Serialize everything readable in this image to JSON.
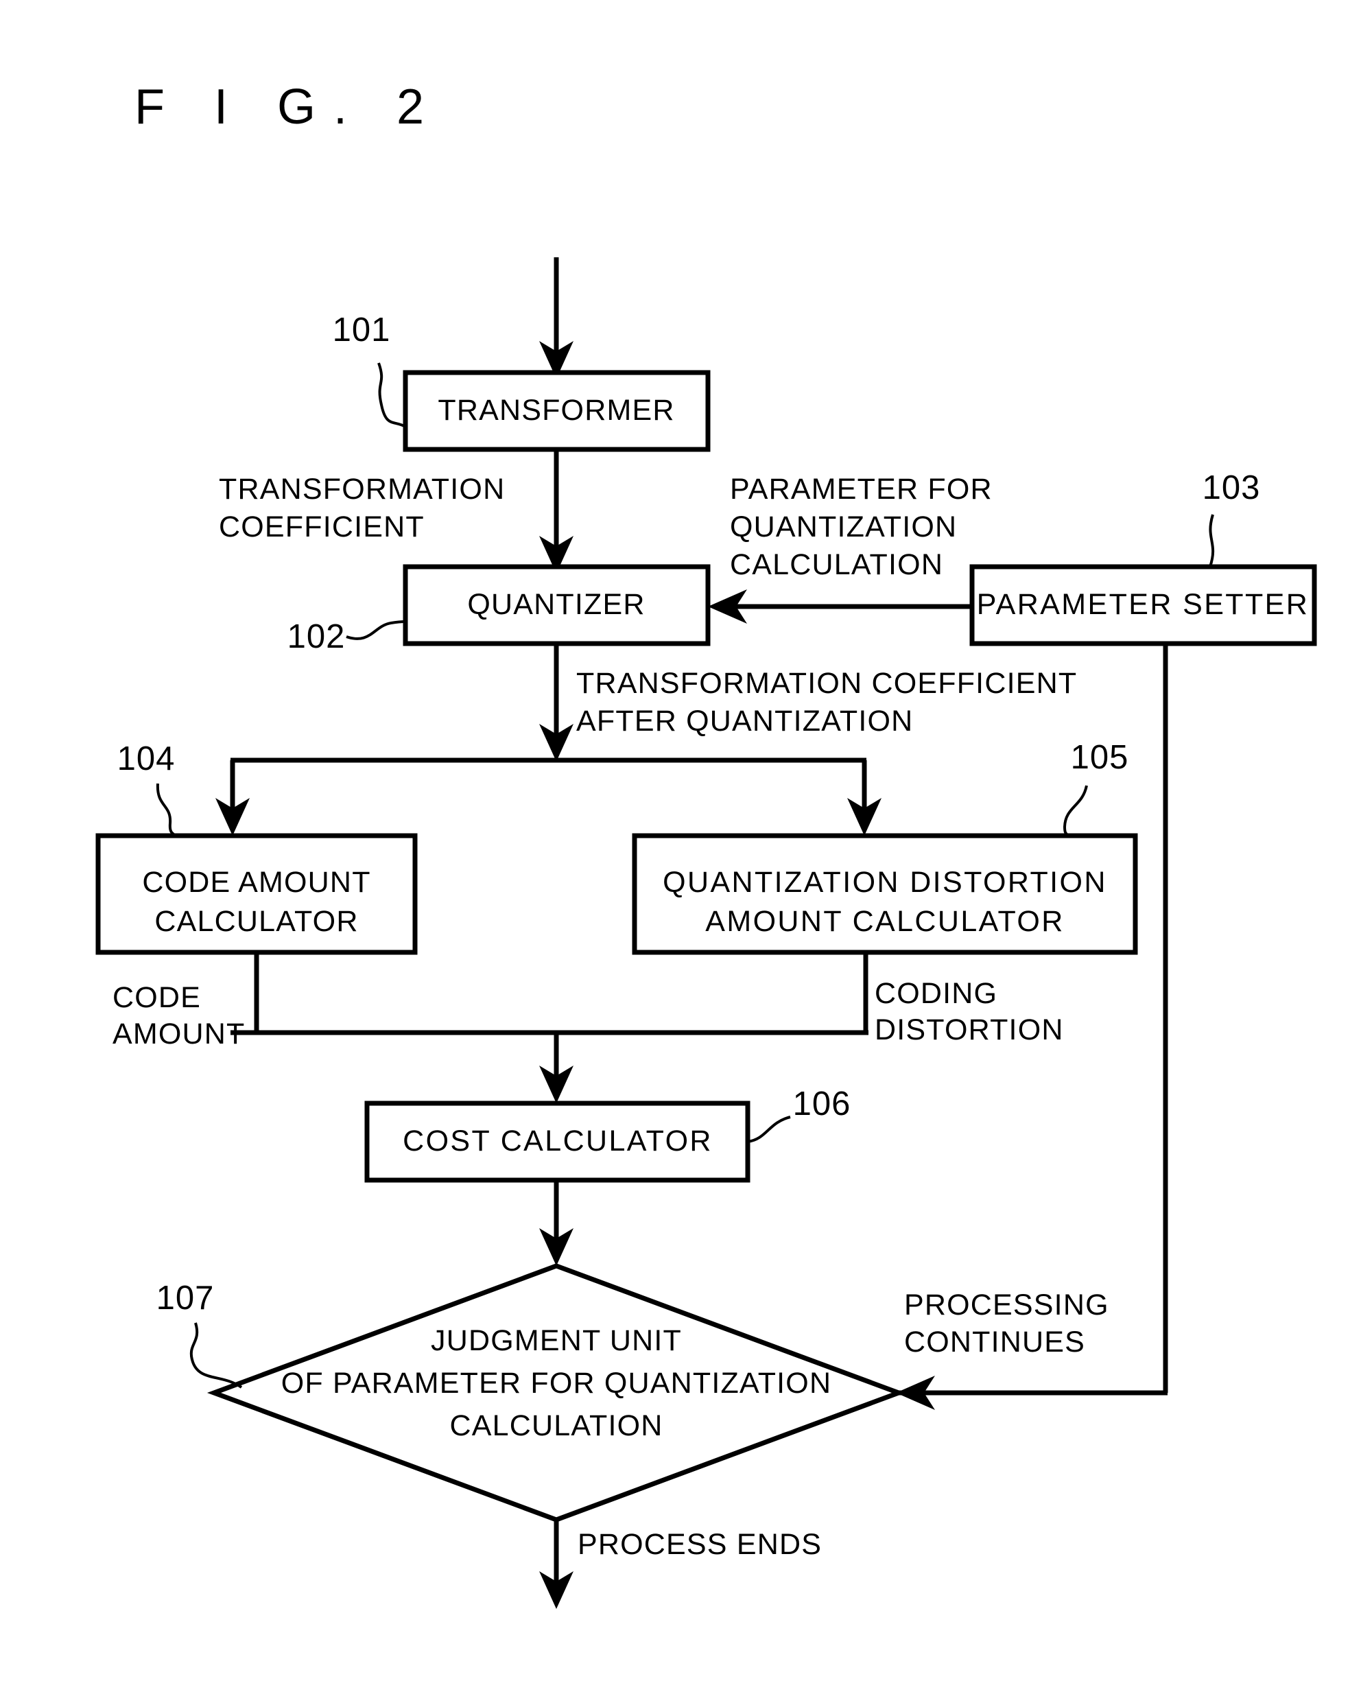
{
  "figure": {
    "title": "F I G.  2"
  },
  "blocks": [
    {
      "ref": "101",
      "label": "TRANSFORMER"
    },
    {
      "ref": "102",
      "label": "QUANTIZER"
    },
    {
      "ref": "103",
      "label": "PARAMETER SETTER"
    },
    {
      "ref": "104",
      "label_line1": "CODE AMOUNT",
      "label_line2": "CALCULATOR"
    },
    {
      "ref": "105",
      "label_line1": "QUANTIZATION DISTORTION",
      "label_line2": "AMOUNT CALCULATOR"
    },
    {
      "ref": "106",
      "label": "COST CALCULATOR"
    },
    {
      "ref": "107",
      "label_line1": "JUDGMENT UNIT",
      "label_line2": "OF PARAMETER FOR QUANTIZATION",
      "label_line3": "CALCULATION"
    }
  ],
  "refs": {
    "r101": "101",
    "r102": "102",
    "r103": "103",
    "r104": "104",
    "r105": "105",
    "r106": "106",
    "r107": "107"
  },
  "flow_labels": {
    "transformation_coefficient_l1": "TRANSFORMATION",
    "transformation_coefficient_l2": "COEFFICIENT",
    "param_for_quant_calc_l1": "PARAMETER FOR",
    "param_for_quant_calc_l2": "QUANTIZATION",
    "param_for_quant_calc_l3": "CALCULATION",
    "coeff_after_quant_l1": "TRANSFORMATION COEFFICIENT",
    "coeff_after_quant_l2": "AFTER QUANTIZATION",
    "code_amount_l1": "CODE",
    "code_amount_l2": "AMOUNT",
    "coding_distortion_l1": "CODING",
    "coding_distortion_l2": "DISTORTION",
    "processing_continues_l1": "PROCESSING",
    "processing_continues_l2": "CONTINUES",
    "process_ends": "PROCESS ENDS"
  },
  "colors": {
    "ink": "#000000",
    "paper": "#ffffff"
  }
}
